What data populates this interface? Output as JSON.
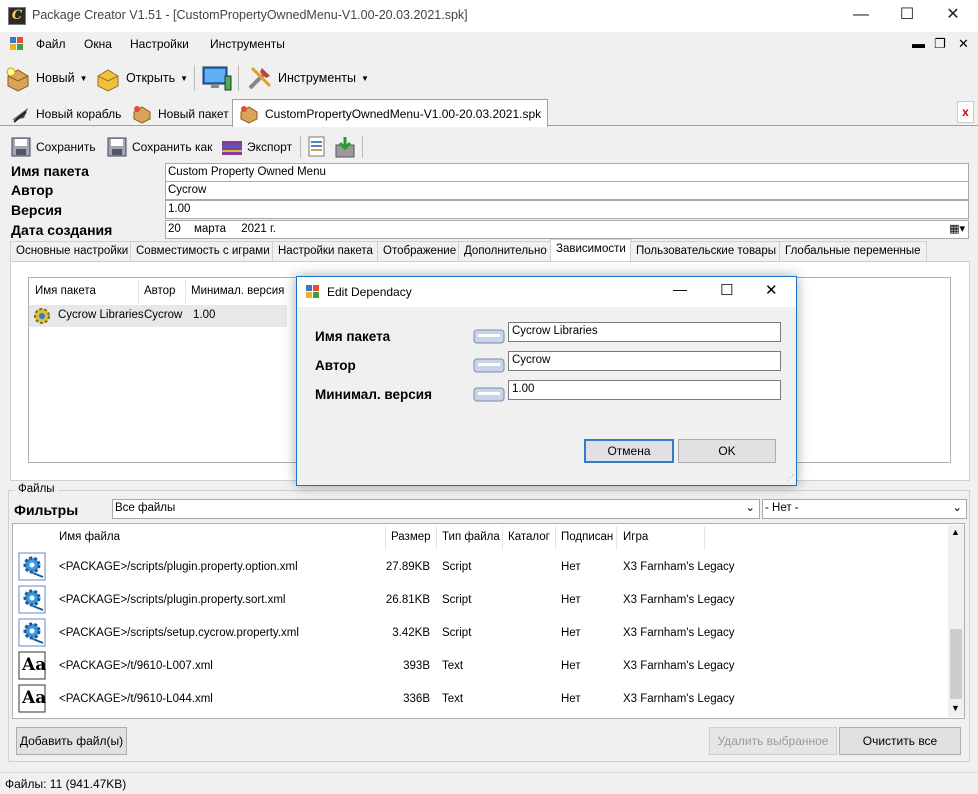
{
  "window": {
    "title": "Package Creator V1.51 - [CustomPropertyOwnedMenu-V1.00-20.03.2021.spk]",
    "app_icon_letter": "C"
  },
  "menu": [
    "Файл",
    "Окна",
    "Настройки",
    "Инструменты"
  ],
  "toolbar": {
    "new_label": "Новый",
    "open_label": "Открыть",
    "tools_label": "Инструменты"
  },
  "doc_tabs": [
    "Новый корабль",
    "Новый пакет",
    "CustomPropertyOwnedMenu-V1.00-20.03.2021.spk"
  ],
  "close_symbol": "x",
  "pkg_toolbar": {
    "save": "Сохранить",
    "save_as": "Сохранить как",
    "export": "Экспорт"
  },
  "props": {
    "name_label": "Имя пакета",
    "name_value": "Custom Property Owned Menu",
    "author_label": "Автор",
    "author_value": "Cycrow",
    "version_label": "Версия",
    "version_value": "1.00",
    "date_label": "Дата создания",
    "date_day": "20",
    "date_month": "марта",
    "date_year": "2021 г."
  },
  "option_tabs": [
    "Основные настройки",
    "Совместимость с играми",
    "Настройки пакета",
    "Отображение",
    "Дополнительно",
    "Зависимости",
    "Пользовательские товары",
    "Глобальные переменные"
  ],
  "dependencies": {
    "columns": [
      "Имя пакета",
      "Автор",
      "Минимал. версия"
    ],
    "rows": [
      {
        "name": "Cycrow Libraries",
        "author": "Cycrow",
        "version": "1.00"
      }
    ]
  },
  "files": {
    "group_label": "Файлы",
    "filter_label": "Фильтры",
    "filter_value": "Все файлы",
    "game_filter_value": "- Нет -",
    "columns": [
      "Имя файла",
      "Размер",
      "Тип файла",
      "Каталог",
      "Подписан",
      "Игра"
    ],
    "rows": [
      {
        "file": "<PACKAGE>/scripts/plugin.property.option.xml",
        "size": "27.89KB",
        "type": "Script",
        "dir": "",
        "signed": "Нет",
        "game": "X3 Farnham's Legacy",
        "icon": "script-gear-icon"
      },
      {
        "file": "<PACKAGE>/scripts/plugin.property.sort.xml",
        "size": "26.81KB",
        "type": "Script",
        "dir": "",
        "signed": "Нет",
        "game": "X3 Farnham's Legacy",
        "icon": "script-gear-icon"
      },
      {
        "file": "<PACKAGE>/scripts/setup.cycrow.property.xml",
        "size": "3.42KB",
        "type": "Script",
        "dir": "",
        "signed": "Нет",
        "game": "X3 Farnham's Legacy",
        "icon": "script-gear-icon"
      },
      {
        "file": "<PACKAGE>/t/9610-L007.xml",
        "size": "393B",
        "type": "Text",
        "dir": "",
        "signed": "Нет",
        "game": "X3 Farnham's Legacy",
        "icon": "text-file-icon"
      },
      {
        "file": "<PACKAGE>/t/9610-L044.xml",
        "size": "336B",
        "type": "Text",
        "dir": "",
        "signed": "Нет",
        "game": "X3 Farnham's Legacy",
        "icon": "text-file-icon"
      }
    ],
    "text_icon_glyph": "Aa",
    "add_button": "Добавить файл(ы)",
    "remove_button": "Удалить выбранное",
    "clear_button": "Очистить все"
  },
  "status": "Файлы: 11 (941.47KB)",
  "dialog": {
    "title": "Edit Dependacy",
    "name_label": "Имя пакета",
    "name_value": "Cycrow Libraries",
    "author_label": "Автор",
    "author_value": "Cycrow",
    "version_label": "Минимал. версия",
    "version_value": "1.00",
    "cancel": "Отмена",
    "ok": "OK"
  }
}
